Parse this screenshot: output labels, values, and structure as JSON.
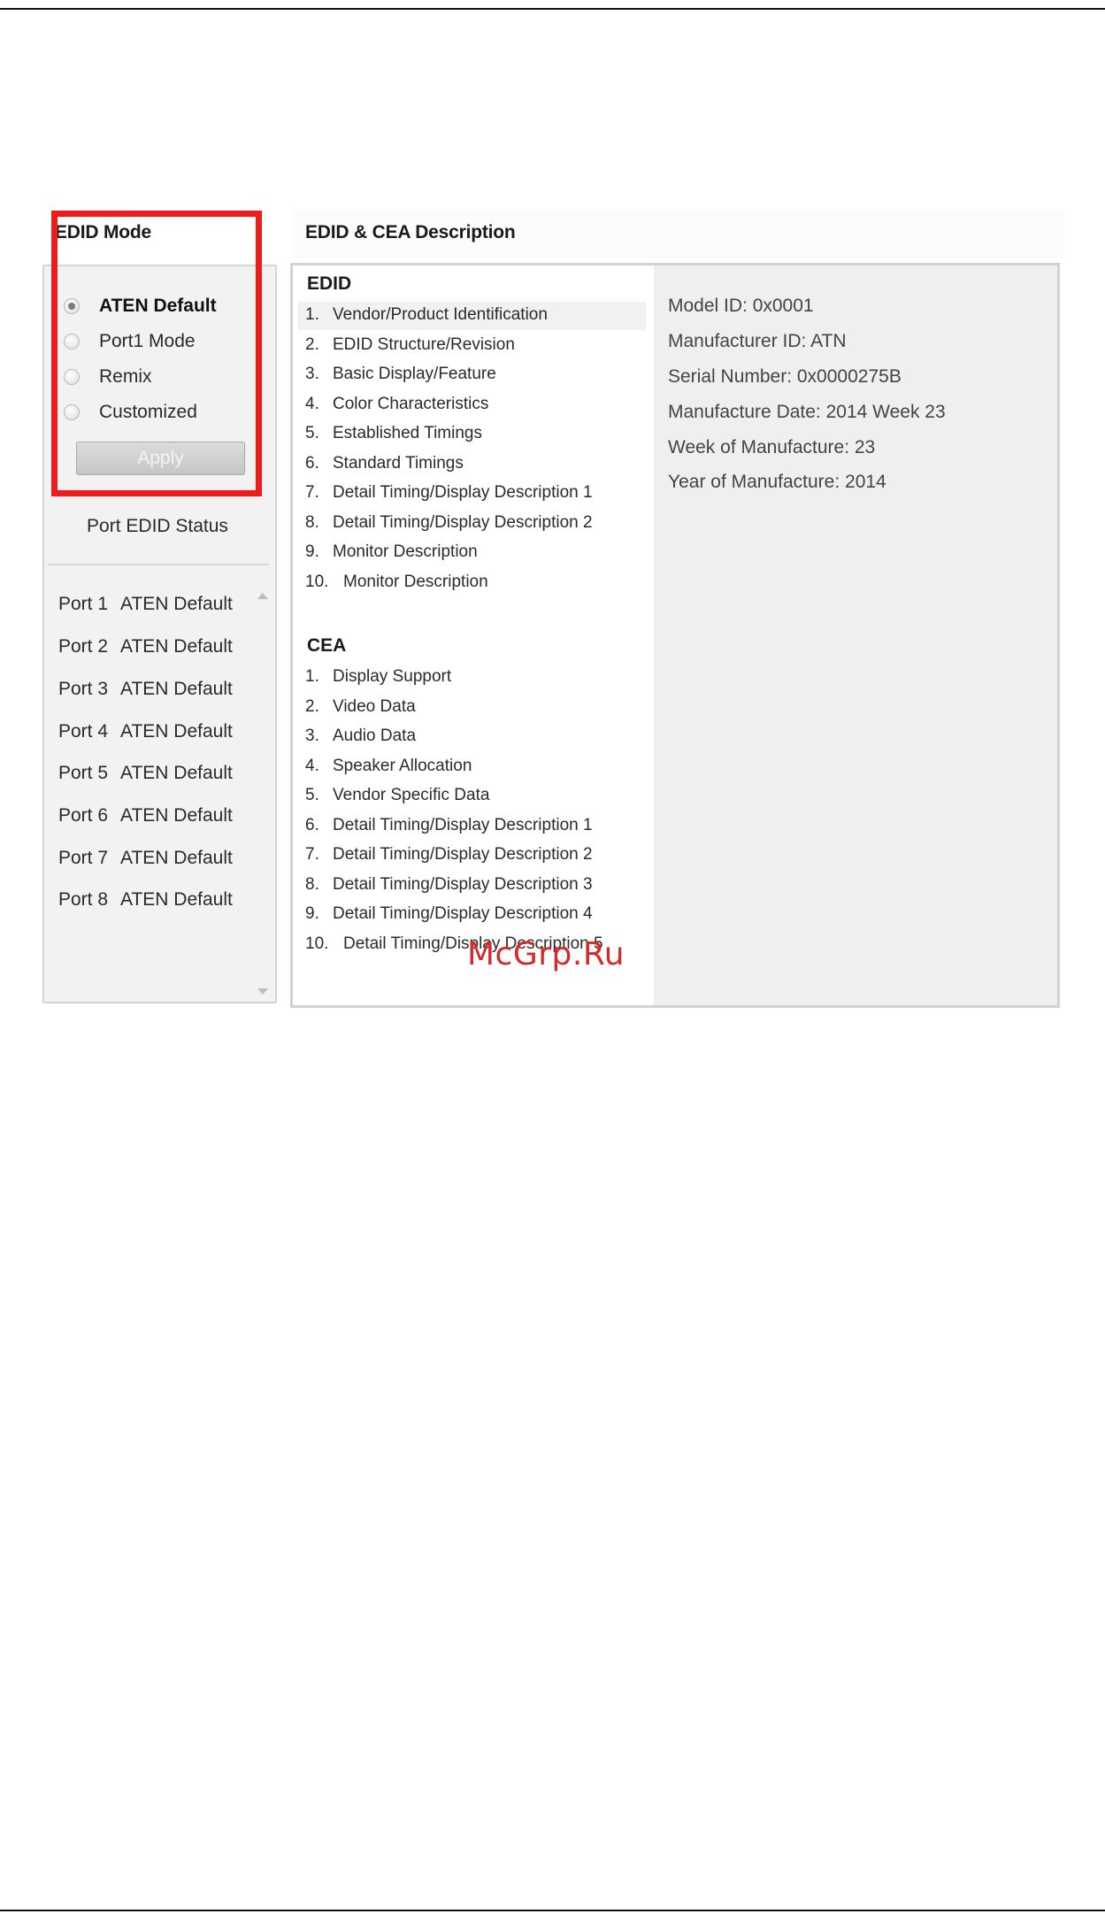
{
  "headings": {
    "edid_mode": "EDID Mode",
    "description": "EDID & CEA Description"
  },
  "edid_modes": [
    {
      "label": "ATEN Default",
      "checked": true
    },
    {
      "label": "Port1 Mode",
      "checked": false
    },
    {
      "label": "Remix",
      "checked": false
    },
    {
      "label": "Customized",
      "checked": false
    }
  ],
  "apply_label": "Apply",
  "port_status": {
    "title": "Port EDID Status",
    "ports": [
      {
        "port": "Port 1",
        "value": "ATEN Default"
      },
      {
        "port": "Port 2",
        "value": "ATEN Default"
      },
      {
        "port": "Port 3",
        "value": "ATEN Default"
      },
      {
        "port": "Port 4",
        "value": "ATEN Default"
      },
      {
        "port": "Port 5",
        "value": "ATEN Default"
      },
      {
        "port": "Port 6",
        "value": "ATEN Default"
      },
      {
        "port": "Port 7",
        "value": "ATEN Default"
      },
      {
        "port": "Port 8",
        "value": "ATEN Default"
      }
    ]
  },
  "edid_section": {
    "title": "EDID",
    "items": [
      {
        "num": "1.",
        "label": "Vendor/Product Identification",
        "selected": true
      },
      {
        "num": "2.",
        "label": "EDID Structure/Revision"
      },
      {
        "num": "3.",
        "label": "Basic Display/Feature"
      },
      {
        "num": "4.",
        "label": "Color Characteristics"
      },
      {
        "num": "5.",
        "label": "Established Timings"
      },
      {
        "num": "6.",
        "label": "Standard Timings"
      },
      {
        "num": "7.",
        "label": "Detail Timing/Display Description 1"
      },
      {
        "num": "8.",
        "label": "Detail Timing/Display Description 2"
      },
      {
        "num": "9.",
        "label": "Monitor Description"
      },
      {
        "num": "10.",
        "label": "Monitor Description"
      }
    ]
  },
  "cea_section": {
    "title": "CEA",
    "items": [
      {
        "num": "1.",
        "label": "Display Support"
      },
      {
        "num": "2.",
        "label": "Video Data"
      },
      {
        "num": "3.",
        "label": "Audio Data"
      },
      {
        "num": "4.",
        "label": "Speaker Allocation"
      },
      {
        "num": "5.",
        "label": "Vendor Specific Data"
      },
      {
        "num": "6.",
        "label": "Detail Timing/Display Description 1"
      },
      {
        "num": "7.",
        "label": "Detail Timing/Display Description 2"
      },
      {
        "num": "8.",
        "label": "Detail Timing/Display Description 3"
      },
      {
        "num": "9.",
        "label": "Detail Timing/Display Description 4"
      },
      {
        "num": "10.",
        "label": "Detail Timing/Display Description 5"
      }
    ]
  },
  "details": [
    "Model ID: 0x0001",
    "Manufacturer ID: ATN",
    "Serial Number: 0x0000275B",
    "Manufacture Date: 2014 Week 23",
    "Week of Manufacture: 23",
    "Year of Manufacture: 2014"
  ],
  "watermark": "McGrp.Ru",
  "colors": {
    "highlight_border": "#ee1c1c",
    "watermark": "#d42a2a",
    "panel_bg": "#f2f2f2"
  }
}
